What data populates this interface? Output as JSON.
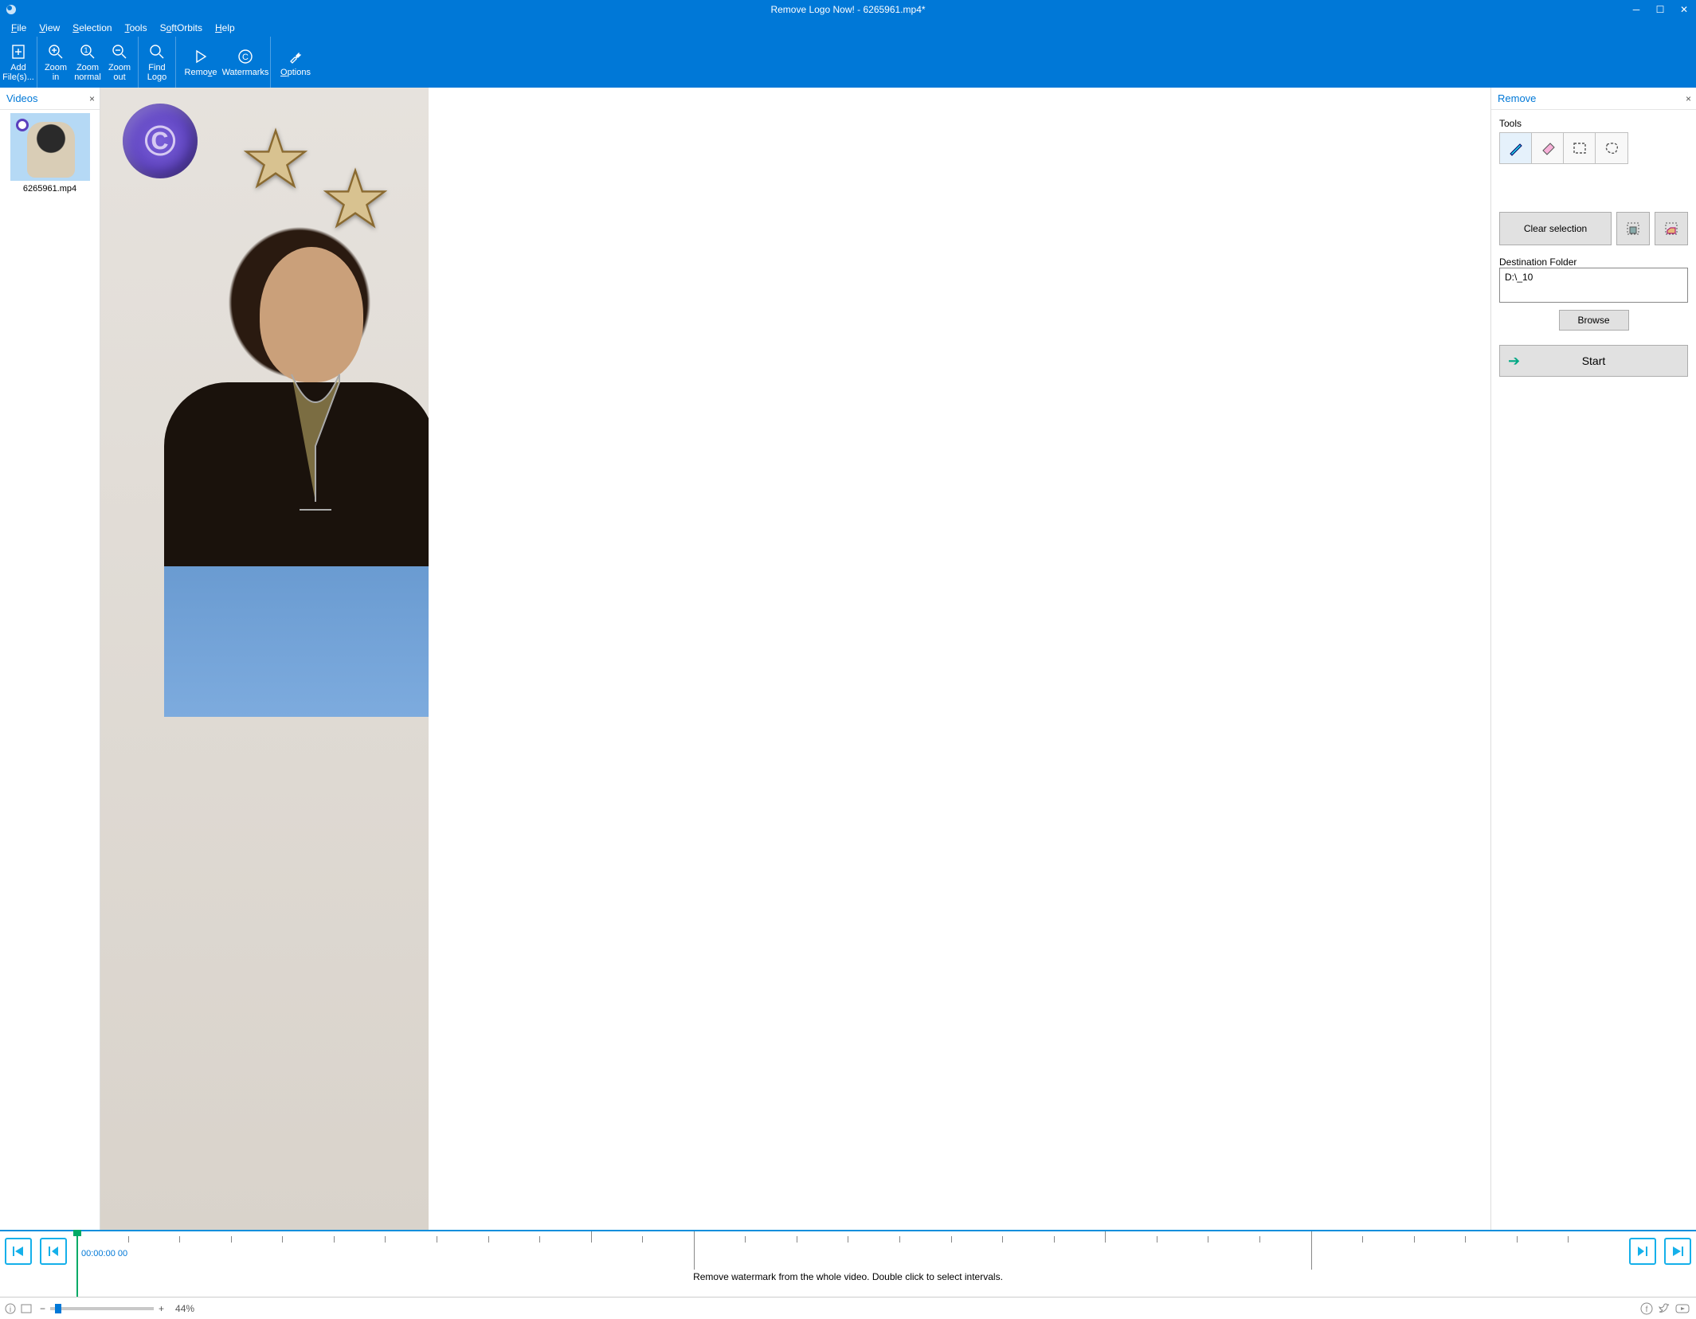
{
  "app": {
    "title": "Remove Logo Now! - 6265961.mp4*"
  },
  "menu": {
    "file": "File",
    "view": "View",
    "selection": "Selection",
    "tools": "Tools",
    "softorbits": "SoftOrbits",
    "help": "Help"
  },
  "toolbar": {
    "add_files": "Add\nFile(s)...",
    "zoom_in": "Zoom\nin",
    "zoom_normal": "Zoom\nnormal",
    "zoom_out": "Zoom\nout",
    "find_logo": "Find\nLogo",
    "remove": "Remove",
    "watermarks": "Watermarks",
    "options": "Options"
  },
  "videos_panel": {
    "title": "Videos",
    "items": [
      {
        "filename": "6265961.mp4"
      }
    ]
  },
  "remove_panel": {
    "title": "Remove",
    "tools_label": "Tools",
    "clear_selection": "Clear selection",
    "destination_label": "Destination Folder",
    "destination_value": "D:\\_10",
    "browse": "Browse",
    "start": "Start"
  },
  "timeline": {
    "time": "00:00:00 00",
    "help": "Remove watermark from the whole video. Double click to select intervals."
  },
  "statusbar": {
    "zoom_percent": "44%"
  }
}
